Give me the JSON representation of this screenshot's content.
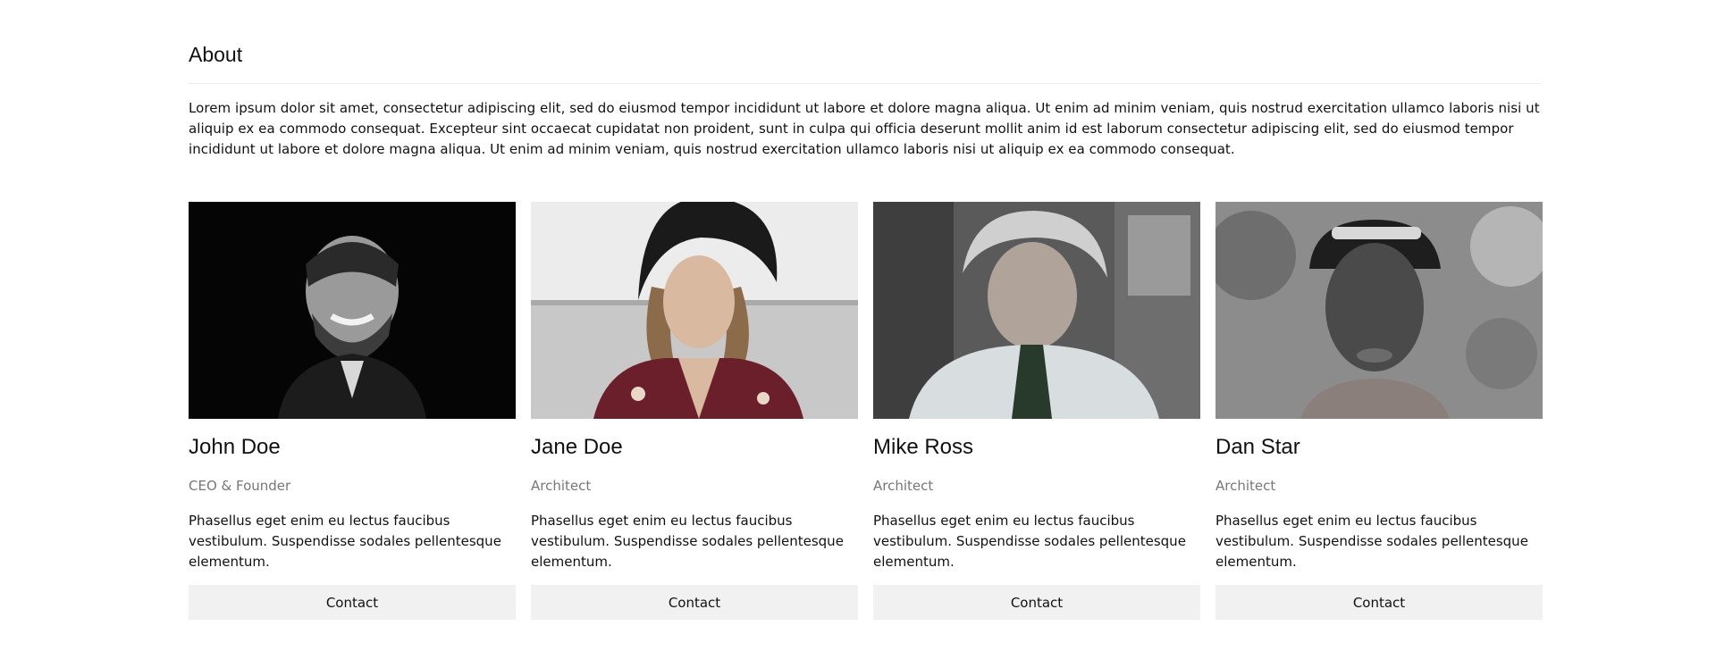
{
  "about": {
    "title": "About",
    "text": "Lorem ipsum dolor sit amet, consectetur adipiscing elit, sed do eiusmod tempor incididunt ut labore et dolore magna aliqua. Ut enim ad minim veniam, quis nostrud exercitation ullamco laboris nisi ut aliquip ex ea commodo consequat. Excepteur sint occaecat cupidatat non proident, sunt in culpa qui officia deserunt mollit anim id est laborum consectetur adipiscing elit, sed do eiusmod tempor incididunt ut labore et dolore magna aliqua. Ut enim ad minim veniam, quis nostrud exercitation ullamco laboris nisi ut aliquip ex ea commodo consequat."
  },
  "team": [
    {
      "name": "John Doe",
      "role": "CEO & Founder",
      "description": "Phasellus eget enim eu lectus faucibus vestibulum. Suspendisse sodales pellentesque elementum.",
      "button": "Contact"
    },
    {
      "name": "Jane Doe",
      "role": "Architect",
      "description": "Phasellus eget enim eu lectus faucibus vestibulum. Suspendisse sodales pellentesque elementum.",
      "button": "Contact"
    },
    {
      "name": "Mike Ross",
      "role": "Architect",
      "description": "Phasellus eget enim eu lectus faucibus vestibulum. Suspendisse sodales pellentesque elementum.",
      "button": "Contact"
    },
    {
      "name": "Dan Star",
      "role": "Architect",
      "description": "Phasellus eget enim eu lectus faucibus vestibulum. Suspendisse sodales pellentesque elementum.",
      "button": "Contact"
    }
  ]
}
